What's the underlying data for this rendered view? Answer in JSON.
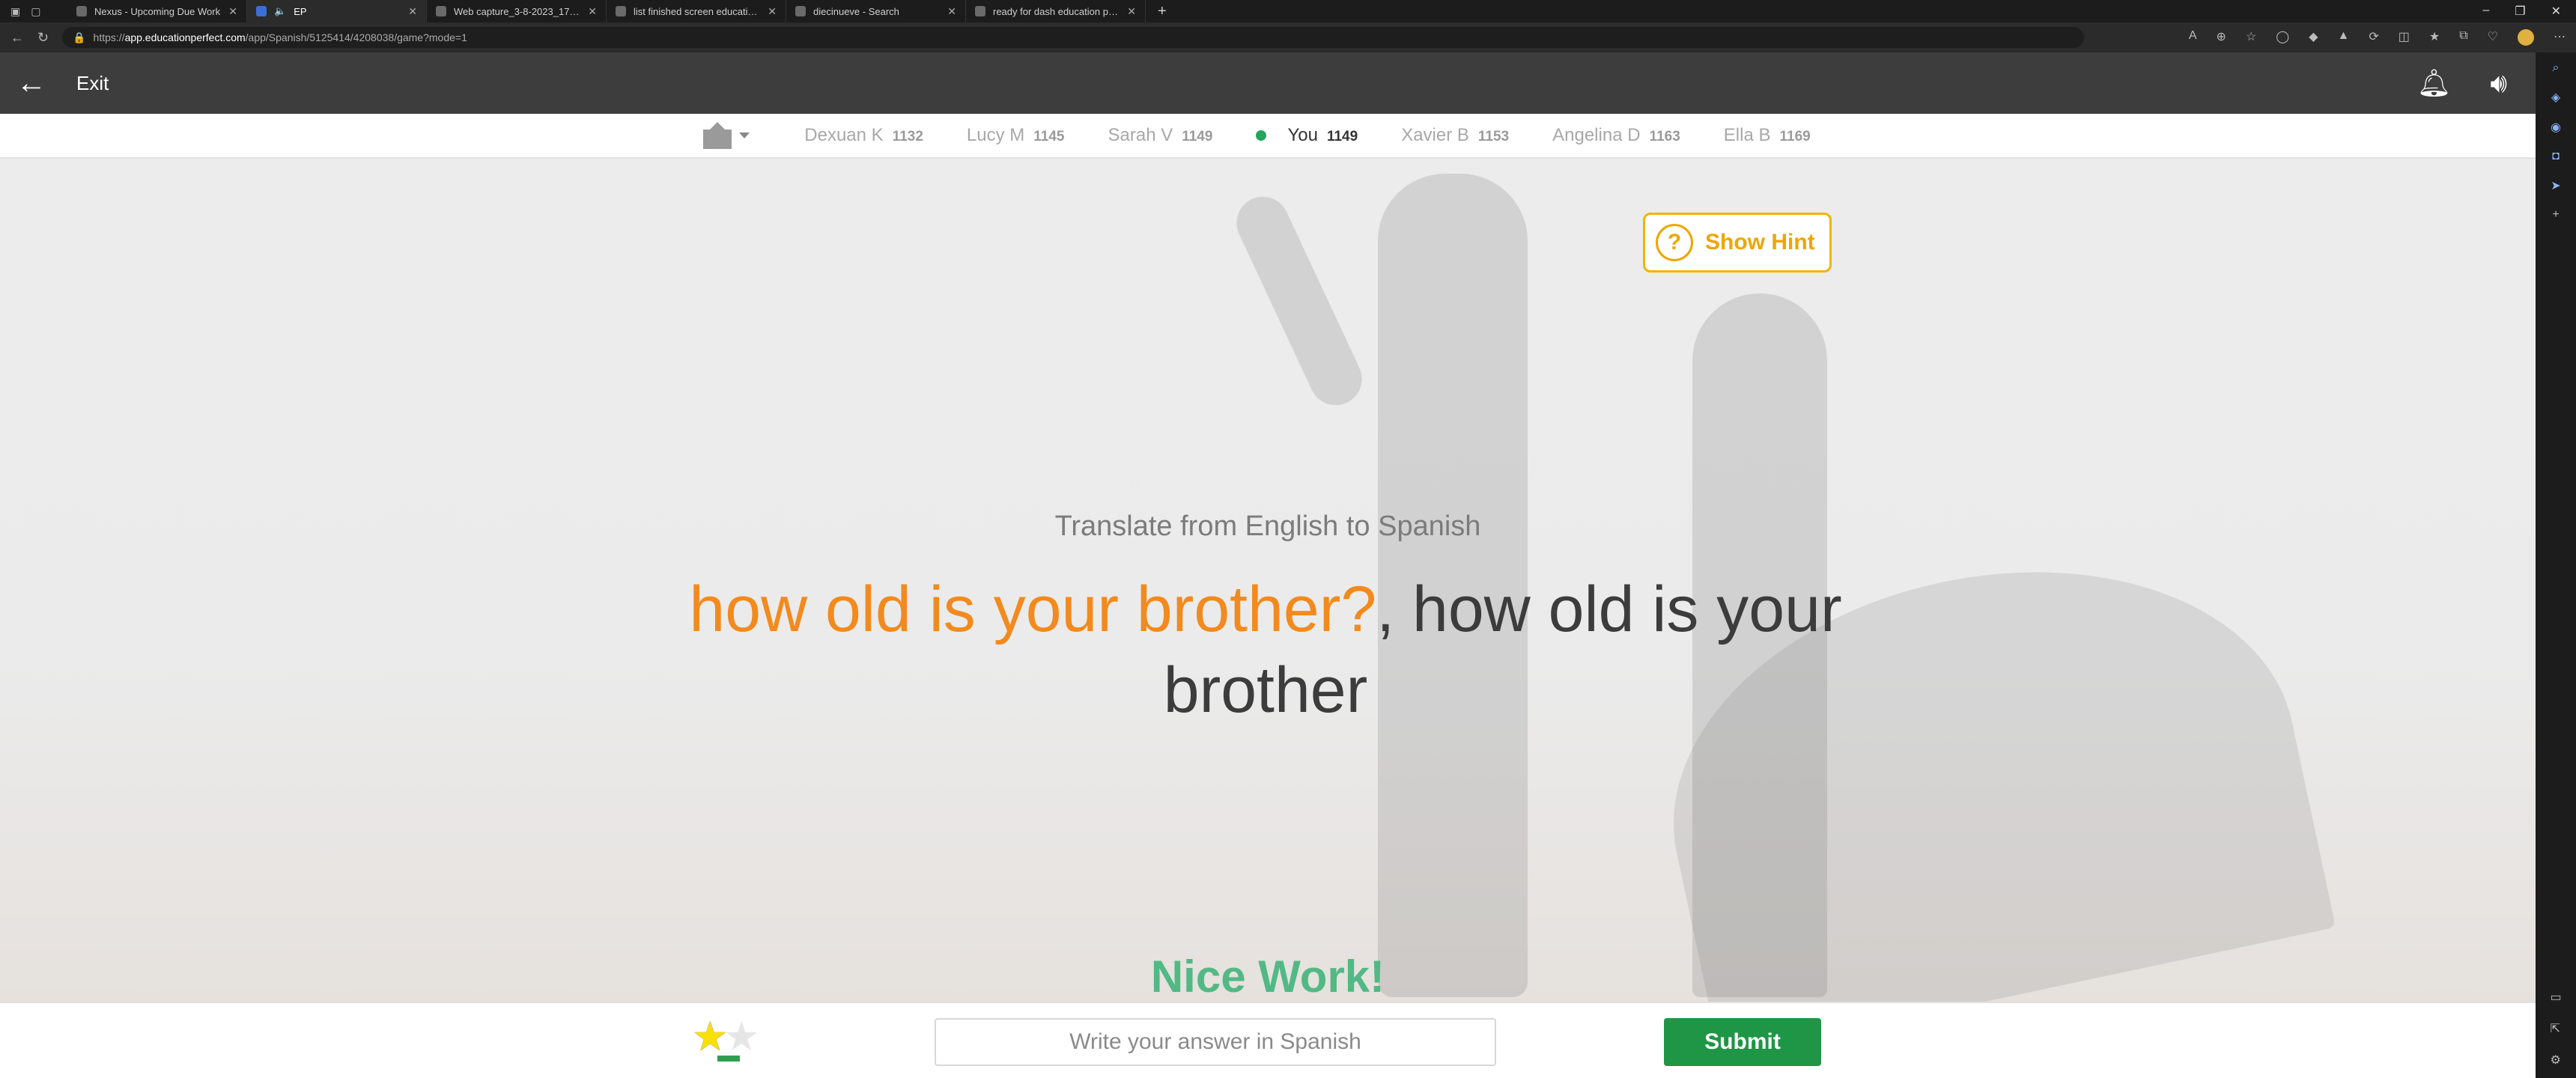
{
  "browser": {
    "tabs": [
      {
        "label": "Nexus - Upcoming Due Work",
        "active": false
      },
      {
        "label": "EP",
        "active": true
      },
      {
        "label": "Web capture_3-8-2023_174346_...",
        "active": false
      },
      {
        "label": "list finished screen education pe...",
        "active": false
      },
      {
        "label": "diecinueve - Search",
        "active": false
      },
      {
        "label": "ready for dash education perfect...",
        "active": false
      }
    ],
    "url_prefix": "https://",
    "url_host": "app.educationperfect.com",
    "url_path": "/app/Spanish/5125414/4208038/game?mode=1"
  },
  "header": {
    "exit_label": "Exit",
    "icons": [
      "back-arrow-icon",
      "bell-icon",
      "speaker-icon"
    ]
  },
  "leaderboard": [
    {
      "name": "Dexuan K",
      "score": "1132",
      "me": false
    },
    {
      "name": "Lucy M",
      "score": "1145",
      "me": false
    },
    {
      "name": "Sarah V",
      "score": "1149",
      "me": false
    },
    {
      "name": "You",
      "score": "1149",
      "me": true
    },
    {
      "name": "Xavier B",
      "score": "1153",
      "me": false
    },
    {
      "name": "Angelina D",
      "score": "1163",
      "me": false
    },
    {
      "name": "Ella B",
      "score": "1169",
      "me": false
    }
  ],
  "hint": {
    "label": "Show Hint",
    "icon_glyph": "?"
  },
  "prompt": "Translate from English to Spanish",
  "question": {
    "highlight": "how old is your brother?",
    "rest": ", how old is your brother"
  },
  "feedback": "Nice Work!",
  "answer": {
    "placeholder": "Write your answer in Spanish",
    "submit_label": "Submit"
  },
  "stars": {
    "filled": 1,
    "total": 2
  },
  "colors": {
    "accent_orange": "#f28a1e",
    "hint_yellow": "#f4b400",
    "success_green": "#52b985",
    "submit_green": "#1e9646",
    "header_gray": "#3d3d3d"
  }
}
